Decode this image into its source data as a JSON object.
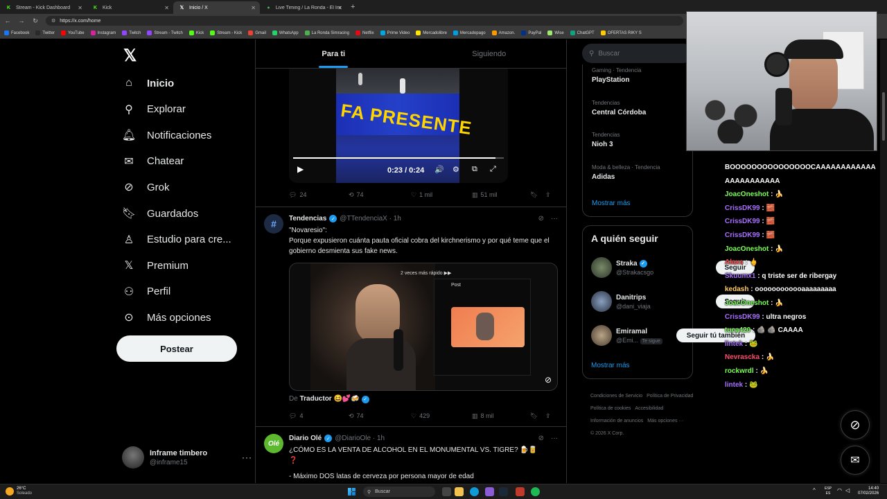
{
  "browser": {
    "tabs": [
      {
        "label": "Stream - Kick Dashboard",
        "icon": "kick-icon"
      },
      {
        "label": "Kick",
        "icon": "kick-icon"
      },
      {
        "label": "Inicio / X",
        "icon": "x-icon"
      },
      {
        "label": "Live Timing / La Ronda - El Instituto",
        "icon": "green-icon"
      }
    ],
    "url": "https://x.com/home",
    "bookmarks": [
      "Facebook",
      "Twitter",
      "YouTube",
      "Instagram",
      "Twitch",
      "Stream - Twitch",
      "Kick",
      "Stream - Kick",
      "Gmail",
      "WhatsApp",
      "La Ronda Simracing",
      "Netflix",
      "Prime Video",
      "Mercadolibre",
      "Mercadopago",
      "Amazon.",
      "PayPal",
      "Wise",
      "ChatGPT",
      "OFERTAS RIKY S"
    ],
    "bookmark_colors": [
      "#1877f2",
      "#2a2a2a",
      "#ff0000",
      "#d6249f",
      "#9146ff",
      "#9146ff",
      "#53fc18",
      "#53fc18",
      "#ea4335",
      "#25d366",
      "#4caf50",
      "#e50914",
      "#00a8e1",
      "#ffe600",
      "#009ee3",
      "#ff9900",
      "#003087",
      "#9fe870",
      "#10a37f",
      "#ffcc00"
    ]
  },
  "nav": {
    "items": [
      {
        "label": "Inicio",
        "icon": "home-icon",
        "bold": true
      },
      {
        "label": "Explorar",
        "icon": "search-icon"
      },
      {
        "label": "Notificaciones",
        "icon": "bell-icon"
      },
      {
        "label": "Chatear",
        "icon": "mail-icon"
      },
      {
        "label": "Grok",
        "icon": "grok-icon"
      },
      {
        "label": "Guardados",
        "icon": "bookmark-icon"
      },
      {
        "label": "Estudio para cre...",
        "icon": "studio-icon"
      },
      {
        "label": "Premium",
        "icon": "x-icon"
      },
      {
        "label": "Perfil",
        "icon": "person-icon"
      },
      {
        "label": "Más opciones",
        "icon": "more-circle-icon"
      }
    ],
    "post_label": "Postear",
    "account": {
      "name": "Inframe timbero",
      "handle": "@inframe15"
    }
  },
  "feed": {
    "tabs": [
      "Para ti",
      "Siguiendo"
    ],
    "video1": {
      "time": "0:23 / 0:24",
      "banner_text": "FA PRESENTE",
      "progress": 0.96
    },
    "tweet1_stats": {
      "replies": "24",
      "reposts": "74",
      "likes": "1 mil",
      "views": "51 mil"
    },
    "tweet2": {
      "name": "Tendencias",
      "handle": "@TTendenciaX · 1h",
      "text1": "\"Novaresio\":",
      "text2": "Porque expusieron cuánta pauta oficial cobra del kirchnerismo y por qué teme que el gobierno desmienta sus fake news.",
      "video_speed_label": "2 veces más rápido ▶▶",
      "inner_post_label": "Post",
      "translator_prefix": "De",
      "translator_name": "Traductor",
      "stats": {
        "replies": "4",
        "reposts": "74",
        "likes": "429",
        "views": "8 mil"
      }
    },
    "tweet3": {
      "name": "Diario Olé",
      "handle": "@DiarioOle · 1h",
      "avatar_text": "Olé",
      "text": "¿CÓMO ES LA VENTA DE ALCOHOL EN EL MONUMENTAL VS. TIGRE?",
      "text2": "- Máximo DOS latas de cerveza por persona mayor de edad"
    }
  },
  "sidebar": {
    "search_placeholder": "Buscar",
    "trends": [
      {
        "meta": "Gaming · Tendencia",
        "topic": "PlayStation"
      },
      {
        "meta": "Tendencias",
        "topic": "Central Córdoba"
      },
      {
        "meta": "Tendencias",
        "topic": "Nioh 3"
      },
      {
        "meta": "Moda & belleza · Tendencia",
        "topic": "Adidas"
      }
    ],
    "show_more": "Mostrar más",
    "follow_title": "A quién seguir",
    "follow": [
      {
        "name": "Straka",
        "handle": "@Strakacsgo",
        "button": "Seguir"
      },
      {
        "name": "Danitrips",
        "handle": "@dani_viaja",
        "button": "Seguir"
      },
      {
        "name": "Emiramal",
        "handle": "@Emi...",
        "badge": "Te sigue",
        "button": "Seguir tú también"
      }
    ],
    "footer": [
      "Condiciones de Servicio",
      "Política de Privacidad",
      "Política de cookies",
      "Accesibilidad",
      "Información de anuncios",
      "Más opciones ···",
      "© 2026 X Corp."
    ]
  },
  "chat": {
    "messages": [
      {
        "user": "",
        "text": "BOOOOOOOOOOOOOOOCAAAAAAAAAAAAAAAAAAAAAAA",
        "color": "#ffffff"
      },
      {
        "user": "JoacOneshot",
        "text": "🍌",
        "color": "#7dff5a"
      },
      {
        "user": "CrissDK99",
        "text": "🧱",
        "color": "#a970ff"
      },
      {
        "user": "CrissDK99",
        "text": "🧱",
        "color": "#a970ff"
      },
      {
        "user": "CrissDK99",
        "text": "🧱",
        "color": "#a970ff"
      },
      {
        "user": "JoacOneshot",
        "text": "🍌",
        "color": "#7dff5a"
      },
      {
        "user": "Alaxs",
        "text": "🖕",
        "color": "#ff4d4d"
      },
      {
        "user": "Skuumx1",
        "text": "q triste ser de ribergay",
        "color": "#a970ff"
      },
      {
        "user": "kedash",
        "text": "oooooooooooaaaaaaaaa",
        "color": "#ffcc66"
      },
      {
        "user": "JoacOneshot",
        "text": "🍌",
        "color": "#7dff5a"
      },
      {
        "user": "CrissDK99",
        "text": "ultra negros",
        "color": "#a970ff"
      },
      {
        "user": "tuca420",
        "text": "🪨 🪨 CAAAA",
        "color": "#7dff5a"
      },
      {
        "user": "lintek",
        "text": "🐸",
        "color": "#a970ff"
      },
      {
        "user": "Nevrascka",
        "text": "🍌",
        "color": "#ff4d6d"
      },
      {
        "user": "rockwrdl",
        "text": "🍌",
        "color": "#7dff5a"
      },
      {
        "user": "lintek",
        "text": "🐸",
        "color": "#a970ff"
      }
    ]
  },
  "taskbar": {
    "weather_temp": "26°C",
    "weather_text": "Soleado",
    "search_placeholder": "Buscar",
    "lang": "ESP",
    "lang2": "ES",
    "time": "14:40",
    "date": "07/02/2026"
  }
}
